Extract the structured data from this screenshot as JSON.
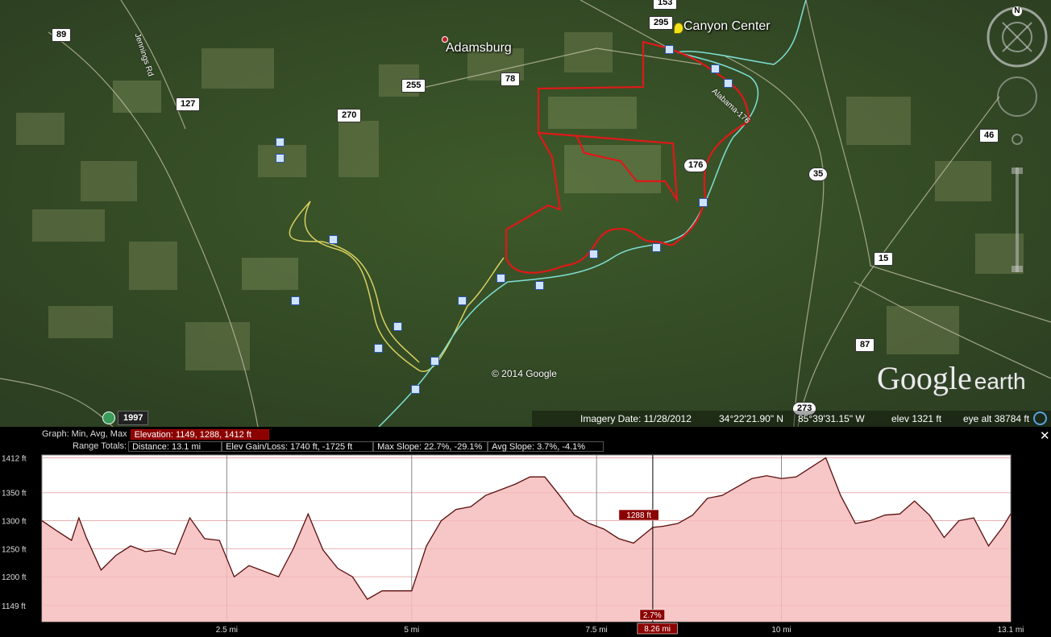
{
  "map": {
    "places": [
      {
        "id": "adamsburg",
        "label": "Adamsburg"
      },
      {
        "id": "canyon-center",
        "label": "Canyon Center"
      }
    ],
    "shields": [
      {
        "id": "89",
        "label": "89"
      },
      {
        "id": "127",
        "label": "127"
      },
      {
        "id": "270",
        "label": "270"
      },
      {
        "id": "255",
        "label": "255"
      },
      {
        "id": "78",
        "label": "78"
      },
      {
        "id": "295",
        "label": "295"
      },
      {
        "id": "153",
        "label": "153"
      },
      {
        "id": "176",
        "label": "176"
      },
      {
        "id": "35",
        "label": "35"
      },
      {
        "id": "46",
        "label": "46"
      },
      {
        "id": "15",
        "label": "15"
      },
      {
        "id": "87",
        "label": "87"
      },
      {
        "id": "273",
        "label": "273"
      }
    ],
    "road_labels": {
      "jennings": "Jennings Rd",
      "alabama": "Alabama-176"
    },
    "copyright": "© 2014 Google",
    "logo": {
      "main": "Google",
      "sub": "earth"
    },
    "year": "1997",
    "status": {
      "imagery_date": "Imagery Date: 11/28/2012",
      "lat": "34°22'21.90\" N",
      "lon": "85°39'31.15\" W",
      "elev": "elev  1321 ft",
      "eye_alt": "eye alt  38784 ft"
    },
    "compass_north": "N"
  },
  "profile": {
    "graph_label": "Graph: Min, Avg, Max",
    "elevation": "Elevation: 1149, 1288, 1412 ft",
    "range_label": "Range Totals:",
    "distance": "Distance: 13.1 mi",
    "gain_loss": "Elev Gain/Loss: 1740 ft, -1725 ft",
    "max_slope": "Max Slope: 22.7%, -29.1%",
    "avg_slope": "Avg Slope: 3.7%, -4.1%",
    "close": "✕",
    "cursor_elev": "1288 ft",
    "cursor_slope": "2.7%",
    "cursor_dist": "8.26 mi"
  },
  "colors": {
    "track": "#e01818",
    "river": "#7fe0d6",
    "road": "#d8d060",
    "fill": "#f6bcbc",
    "line": "#5a0d0d"
  },
  "chart_data": {
    "type": "area",
    "title": "",
    "xlabel": "",
    "ylabel": "",
    "x_tick_labels": [
      "2.5 mi",
      "5 mi",
      "7.5 mi",
      "10 mi",
      "13.1 mi"
    ],
    "x_ticks": [
      2.5,
      5,
      7.5,
      10,
      13.1
    ],
    "y_tick_labels": [
      "1412 ft",
      "1350 ft",
      "1300 ft",
      "1250 ft",
      "1200 ft",
      "1149 ft"
    ],
    "y_ticks": [
      1412,
      1350,
      1300,
      1250,
      1200,
      1149
    ],
    "xlim": [
      0,
      13.1
    ],
    "ylim": [
      1120,
      1417
    ],
    "grid": true,
    "cursor_x": 8.26,
    "x": [
      0,
      0.2,
      0.4,
      0.5,
      0.6,
      0.8,
      1.0,
      1.2,
      1.4,
      1.6,
      1.8,
      2.0,
      2.2,
      2.4,
      2.6,
      2.8,
      3.0,
      3.2,
      3.4,
      3.6,
      3.8,
      4.0,
      4.2,
      4.4,
      4.6,
      4.8,
      5.0,
      5.2,
      5.4,
      5.6,
      5.8,
      6.0,
      6.2,
      6.4,
      6.6,
      6.8,
      7.0,
      7.2,
      7.4,
      7.6,
      7.8,
      8.0,
      8.26,
      8.4,
      8.6,
      8.8,
      9.0,
      9.2,
      9.4,
      9.6,
      9.8,
      10.0,
      10.2,
      10.4,
      10.6,
      10.8,
      11.0,
      11.2,
      11.4,
      11.6,
      11.8,
      12.0,
      12.2,
      12.4,
      12.6,
      12.8,
      13.0,
      13.1
    ],
    "y": [
      1300,
      1282,
      1265,
      1305,
      1270,
      1212,
      1238,
      1255,
      1245,
      1248,
      1240,
      1305,
      1268,
      1265,
      1200,
      1220,
      1210,
      1200,
      1250,
      1312,
      1248,
      1215,
      1200,
      1160,
      1175,
      1175,
      1175,
      1255,
      1300,
      1320,
      1325,
      1345,
      1355,
      1365,
      1378,
      1378,
      1345,
      1310,
      1295,
      1285,
      1268,
      1260,
      1288,
      1290,
      1295,
      1310,
      1340,
      1345,
      1360,
      1375,
      1380,
      1375,
      1378,
      1395,
      1412,
      1345,
      1295,
      1300,
      1310,
      1312,
      1335,
      1310,
      1270,
      1300,
      1305,
      1255,
      1290,
      1312
    ]
  }
}
